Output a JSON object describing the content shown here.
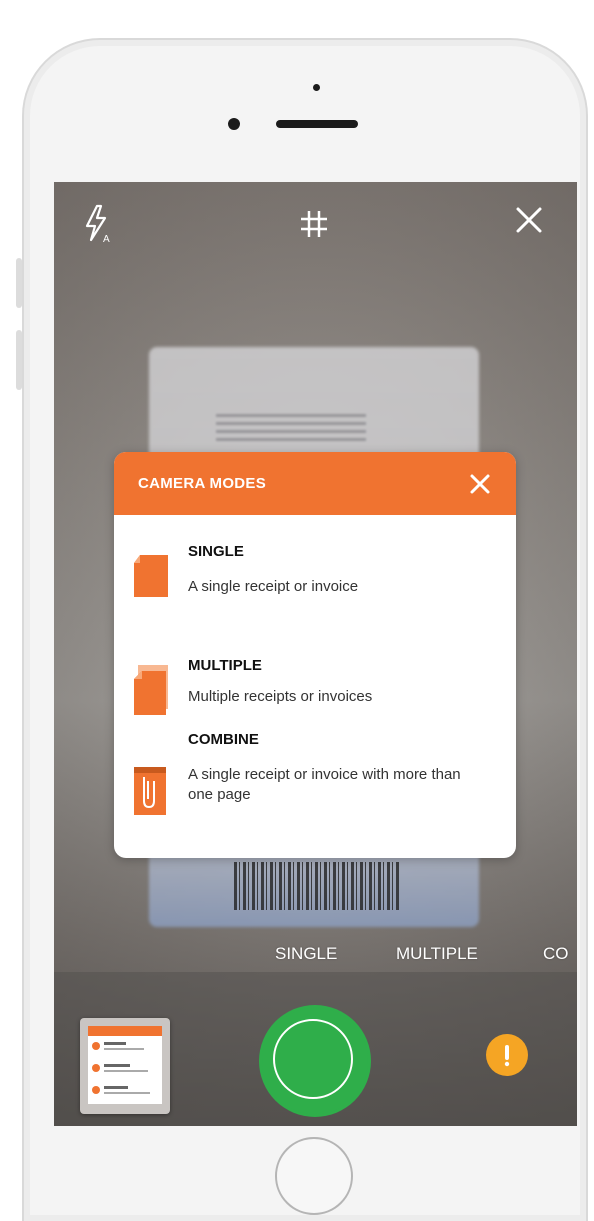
{
  "camera": {
    "top_icons": [
      "flash-auto-icon",
      "grid-icon",
      "close-icon"
    ],
    "mode_strip": [
      "SINGLE",
      "MULTIPLE",
      "CO"
    ]
  },
  "modal": {
    "title": "CAMERA MODES",
    "items": [
      {
        "title": "SINGLE",
        "description": "A single receipt or invoice",
        "icon": "single-document-icon"
      },
      {
        "title": "MULTIPLE",
        "description": "Multiple receipts or invoices",
        "icon": "multiple-documents-icon"
      },
      {
        "title": "COMBINE",
        "description": "A single receipt or invoice with more than one page",
        "icon": "combine-documents-icon"
      }
    ]
  },
  "colors": {
    "accent": "#f07330",
    "shutter": "#2fae4a",
    "info": "#f5a524"
  }
}
